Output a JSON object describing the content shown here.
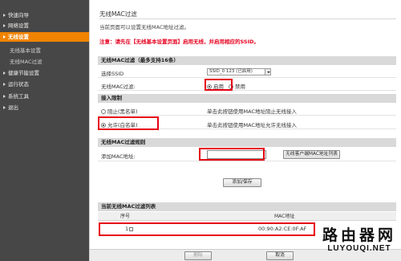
{
  "sidebar": {
    "items": [
      {
        "label": "快速向导"
      },
      {
        "label": "网络设置"
      },
      {
        "label": "无线设置"
      },
      {
        "label": "无线基本设置"
      },
      {
        "label": "无线MAC过滤"
      },
      {
        "label": "健康节能设置"
      },
      {
        "label": "运行状态"
      },
      {
        "label": "系统工具"
      },
      {
        "label": "退出"
      }
    ],
    "active_color": "#f08300"
  },
  "page": {
    "title": "无线MAC过滤",
    "description": "当前页面可以设置无线MAC地址过滤。",
    "note": "注意：请先在【无线基本设置页面】启用无线，并启用相应的SSID。"
  },
  "filter_section": {
    "header": "无线MAC过滤（最多支持16条）",
    "ssid_label": "选择SSID",
    "ssid_value": "SSID_0 123 (已启用)",
    "mac_filter_label": "无线MAC过滤:",
    "enable_label": "启用",
    "disable_label": "禁用"
  },
  "access_section": {
    "header": "接入限制",
    "options": [
      {
        "label": "阻止(黑名单)",
        "desc": "单击此按钮使用MAC地址阻止无线接入"
      },
      {
        "label": "允许(白名单)",
        "desc": "单击此按钮使用MAC地址允许无线接入"
      }
    ]
  },
  "rule_section": {
    "header": "无线MAC过滤规则",
    "add_mac_label": "添加MAC地址:",
    "add_mac_value": "",
    "client_list_button": "无线客户端MAC地址列表",
    "add_save_button": "添加/保存"
  },
  "list_section": {
    "header": "当前无线MAC过滤列表",
    "columns": [
      "序号",
      "MAC地址"
    ],
    "rows": [
      {
        "index": "1",
        "mac": "00:90:A2:CE:0F:AF"
      }
    ]
  },
  "footer": {
    "delete_button": "删除",
    "cancel_button": "取消"
  },
  "watermark": {
    "cn": "路由器网",
    "en": "LUYOUQI.NET"
  },
  "colors": {
    "accent": "#f08300",
    "highlight": "#e60012",
    "note": "#e6001f"
  }
}
